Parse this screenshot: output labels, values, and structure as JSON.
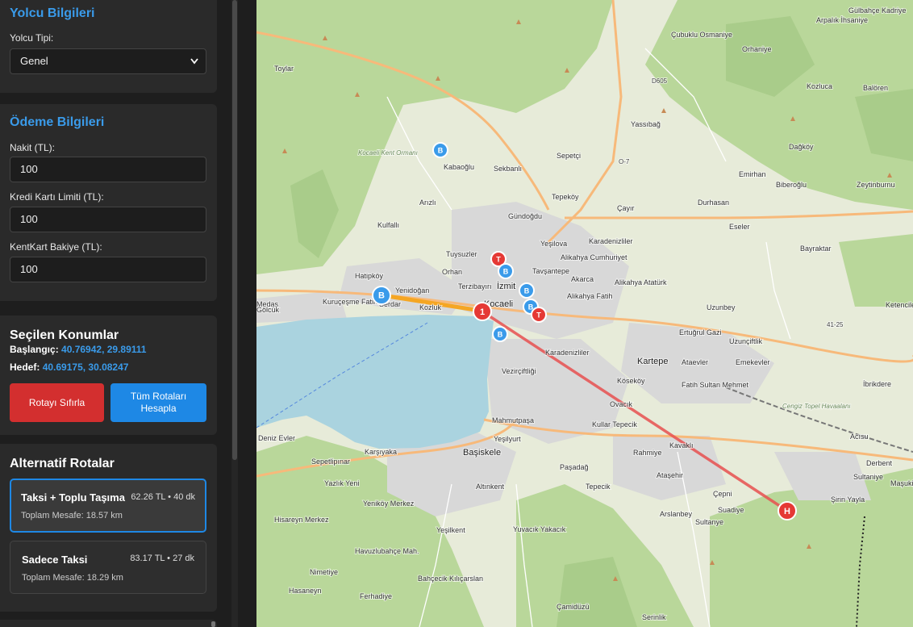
{
  "passenger": {
    "title": "Yolcu Bilgileri",
    "type_label": "Yolcu Tipi:",
    "type_value": "Genel"
  },
  "payment": {
    "title": "Ödeme Bilgileri",
    "cash_label": "Nakit (TL):",
    "cash_value": "100",
    "credit_label": "Kredi Kartı Limiti (TL):",
    "credit_value": "100",
    "kentkart_label": "KentKart Bakiye (TL):",
    "kentkart_value": "100"
  },
  "locations": {
    "title": "Seçilen Konumlar",
    "start_label": "Başlangıç:",
    "start_value": "40.76942, 29.89111",
    "target_label": "Hedef:",
    "target_value": "40.69175, 30.08247",
    "reset_button": "Rotayı Sıfırla",
    "calc_button": "Tüm Rotaları Hesapla"
  },
  "routes": {
    "title": "Alternatif Rotalar",
    "items": [
      {
        "name": "Taksi + Toplu Taşıma",
        "meta": "62.26 TL • 40 dk",
        "distance": "Toplam Mesafe: 18.57 km"
      },
      {
        "name": "Sadece Taksi",
        "meta": "83.17 TL • 27 dk",
        "distance": "Toplam Mesafe: 18.29 km"
      }
    ]
  },
  "colors": {
    "accent": "#3a9bea",
    "reset": "#d32f2f",
    "calc": "#1e88e5",
    "route_line": "#e85050",
    "walk_line": "#f5a623"
  },
  "map": {
    "places": [
      "Gülbahçe Kadriye",
      "Arpalık İhsaniye",
      "Çubuklu Osmaniye",
      "Orhaniye",
      "Toylar",
      "D605",
      "Kozluca",
      "Balören",
      "Yassıbağ",
      "Dağköy",
      "Kocaeli Kent Ormanı",
      "Sepetçi",
      "O-7",
      "Kabaoğlu",
      "Sekbanlı",
      "Emirhan",
      "Biberoğlu",
      "Zeytinburnu",
      "Tepeköy",
      "Arızlı",
      "Gündoğdu",
      "Çayır",
      "Durhasan",
      "Eseler",
      "Yeşilova",
      "Karadenizliler",
      "Bayraktar",
      "Kulfallı",
      "Tuysuzler",
      "Alikahya Cumhuriyet",
      "Tavşantepe",
      "Hatipköy",
      "Akarca",
      "Alikahya Atatürk",
      "Orhan",
      "Yenidoğan",
      "Terzibayırı",
      "İzmit",
      "Alikahya Fatih",
      "Kuruçeşme Fatih",
      "Serdar",
      "Kocaeli",
      "Uzunbey",
      "Ketenciler",
      "Kozluk",
      "Ertuğrul Gazi",
      "41-25",
      "Uzunçiftlik",
      "Karadenizliler",
      "Kartepe",
      "Ataevler",
      "Emekevler",
      "İbrikdere",
      "Vezirçiftliği",
      "Köseköy",
      "Fatih Sultan Mehmet",
      "Ovacık",
      "Cengiz Topel Havaalanı",
      "Mahmutpaşa",
      "Kullar Tepecik",
      "Acısu",
      "Deniz Evler",
      "Yeşilyurt",
      "Rahmiye",
      "Kavaklı",
      "Karşıyaka",
      "Başiskele",
      "Sepetlipınar",
      "Paşadağ",
      "Derbent",
      "Yazlık Yeni",
      "Altınkent",
      "Tepecik",
      "Ataşehir",
      "Sultaniye",
      "Şirin Yayla",
      "Maşukiye",
      "Çepni",
      "Suadiye",
      "Arslanbey",
      "Hisareyn Merkez",
      "Yeniköy Merkez",
      "Sultanye",
      "Havuzlubahçe Mah.",
      "Yeşilkent",
      "Yuvacık Yakacık",
      "Nimetiye",
      "Ferhadiye",
      "Bahçecik Kılıçarslan",
      "Hasaneyn",
      "Çamidüzü",
      "Serinlik",
      "Medaş",
      "Gölcük"
    ],
    "markers": {
      "start": "1",
      "end": "H",
      "bus": "B",
      "tram": "T"
    }
  }
}
